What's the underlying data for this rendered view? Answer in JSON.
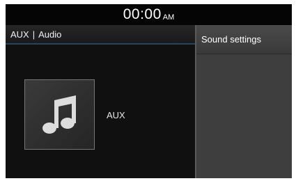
{
  "status_bar": {
    "time": "00:00",
    "ampm": "AM"
  },
  "source_header": {
    "source": "AUX",
    "separator": "|",
    "mode": "Audio"
  },
  "main": {
    "album_art_icon": "music-note-icon",
    "source_label": "AUX"
  },
  "side_menu": {
    "sound_settings_label": "Sound settings"
  },
  "colors": {
    "background": "#0d0d0d",
    "header_underline": "#24465f",
    "side_panel": "#3a3a3a"
  }
}
